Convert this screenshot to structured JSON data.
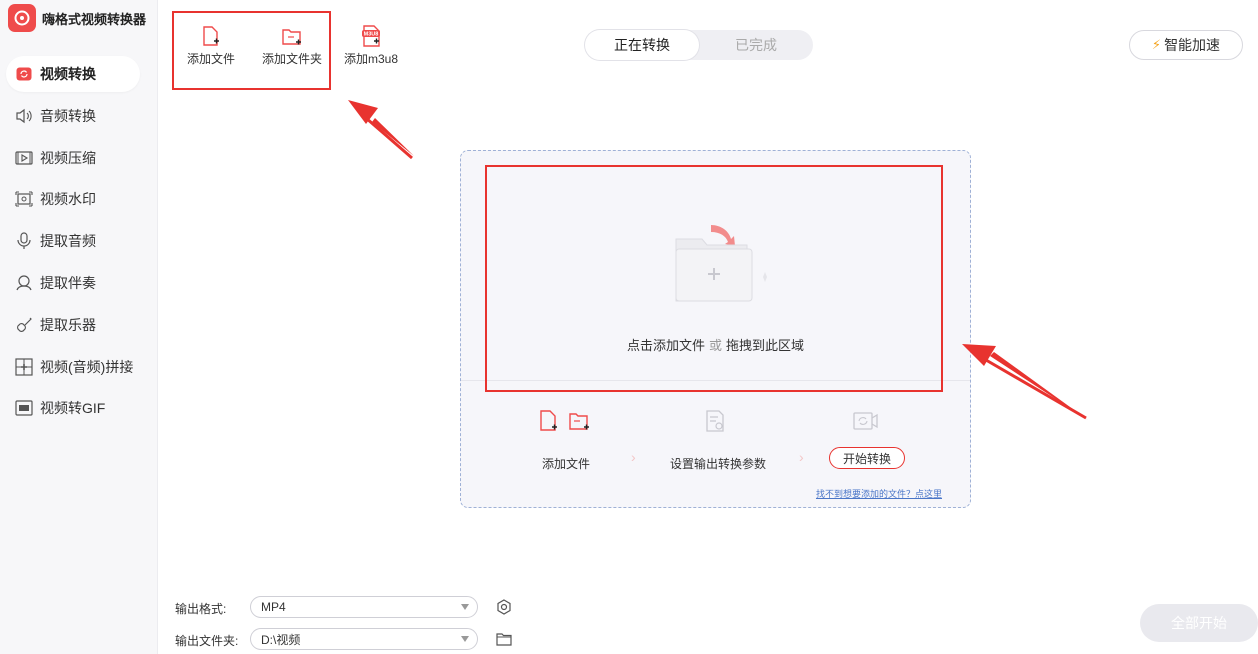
{
  "app": {
    "title": "嗨格式视频转换器"
  },
  "sidebar": {
    "items": [
      {
        "label": "视频转换",
        "icon": "video-convert-icon"
      },
      {
        "label": "音频转换",
        "icon": "speaker-icon"
      },
      {
        "label": "视频压缩",
        "icon": "video-compress-icon"
      },
      {
        "label": "视频水印",
        "icon": "watermark-icon"
      },
      {
        "label": "提取音频",
        "icon": "microphone-icon"
      },
      {
        "label": "提取伴奏",
        "icon": "headset-icon"
      },
      {
        "label": "提取乐器",
        "icon": "guitar-icon"
      },
      {
        "label": "视频(音频)拼接",
        "icon": "merge-icon"
      },
      {
        "label": "视频转GIF",
        "icon": "gif-icon"
      }
    ]
  },
  "toolbar": {
    "add_file": "添加文件",
    "add_folder": "添加文件夹",
    "add_m3u8": "添加m3u8",
    "m3u8_badge": "M3U8"
  },
  "tabs": {
    "converting": "正在转换",
    "completed": "已完成"
  },
  "boost": {
    "label": "智能加速"
  },
  "dropzone": {
    "text_click": "点击添加文件",
    "text_or": "或",
    "text_drag": "拖拽到此区域",
    "steps": {
      "add_file": "添加文件",
      "set_params": "设置输出转换参数",
      "start": "开始转换"
    },
    "help_link": "找不到想要添加的文件？点这里"
  },
  "bottom": {
    "format_label": "输出格式:",
    "format_value": "MP4",
    "folder_label": "输出文件夹:",
    "folder_value": "D:\\视频",
    "start_all": "全部开始"
  },
  "colors": {
    "accent": "#e8332f",
    "brand": "#ef4b4b",
    "highlight_box": "#e8332f",
    "boost_bolt": "#f5a623"
  }
}
